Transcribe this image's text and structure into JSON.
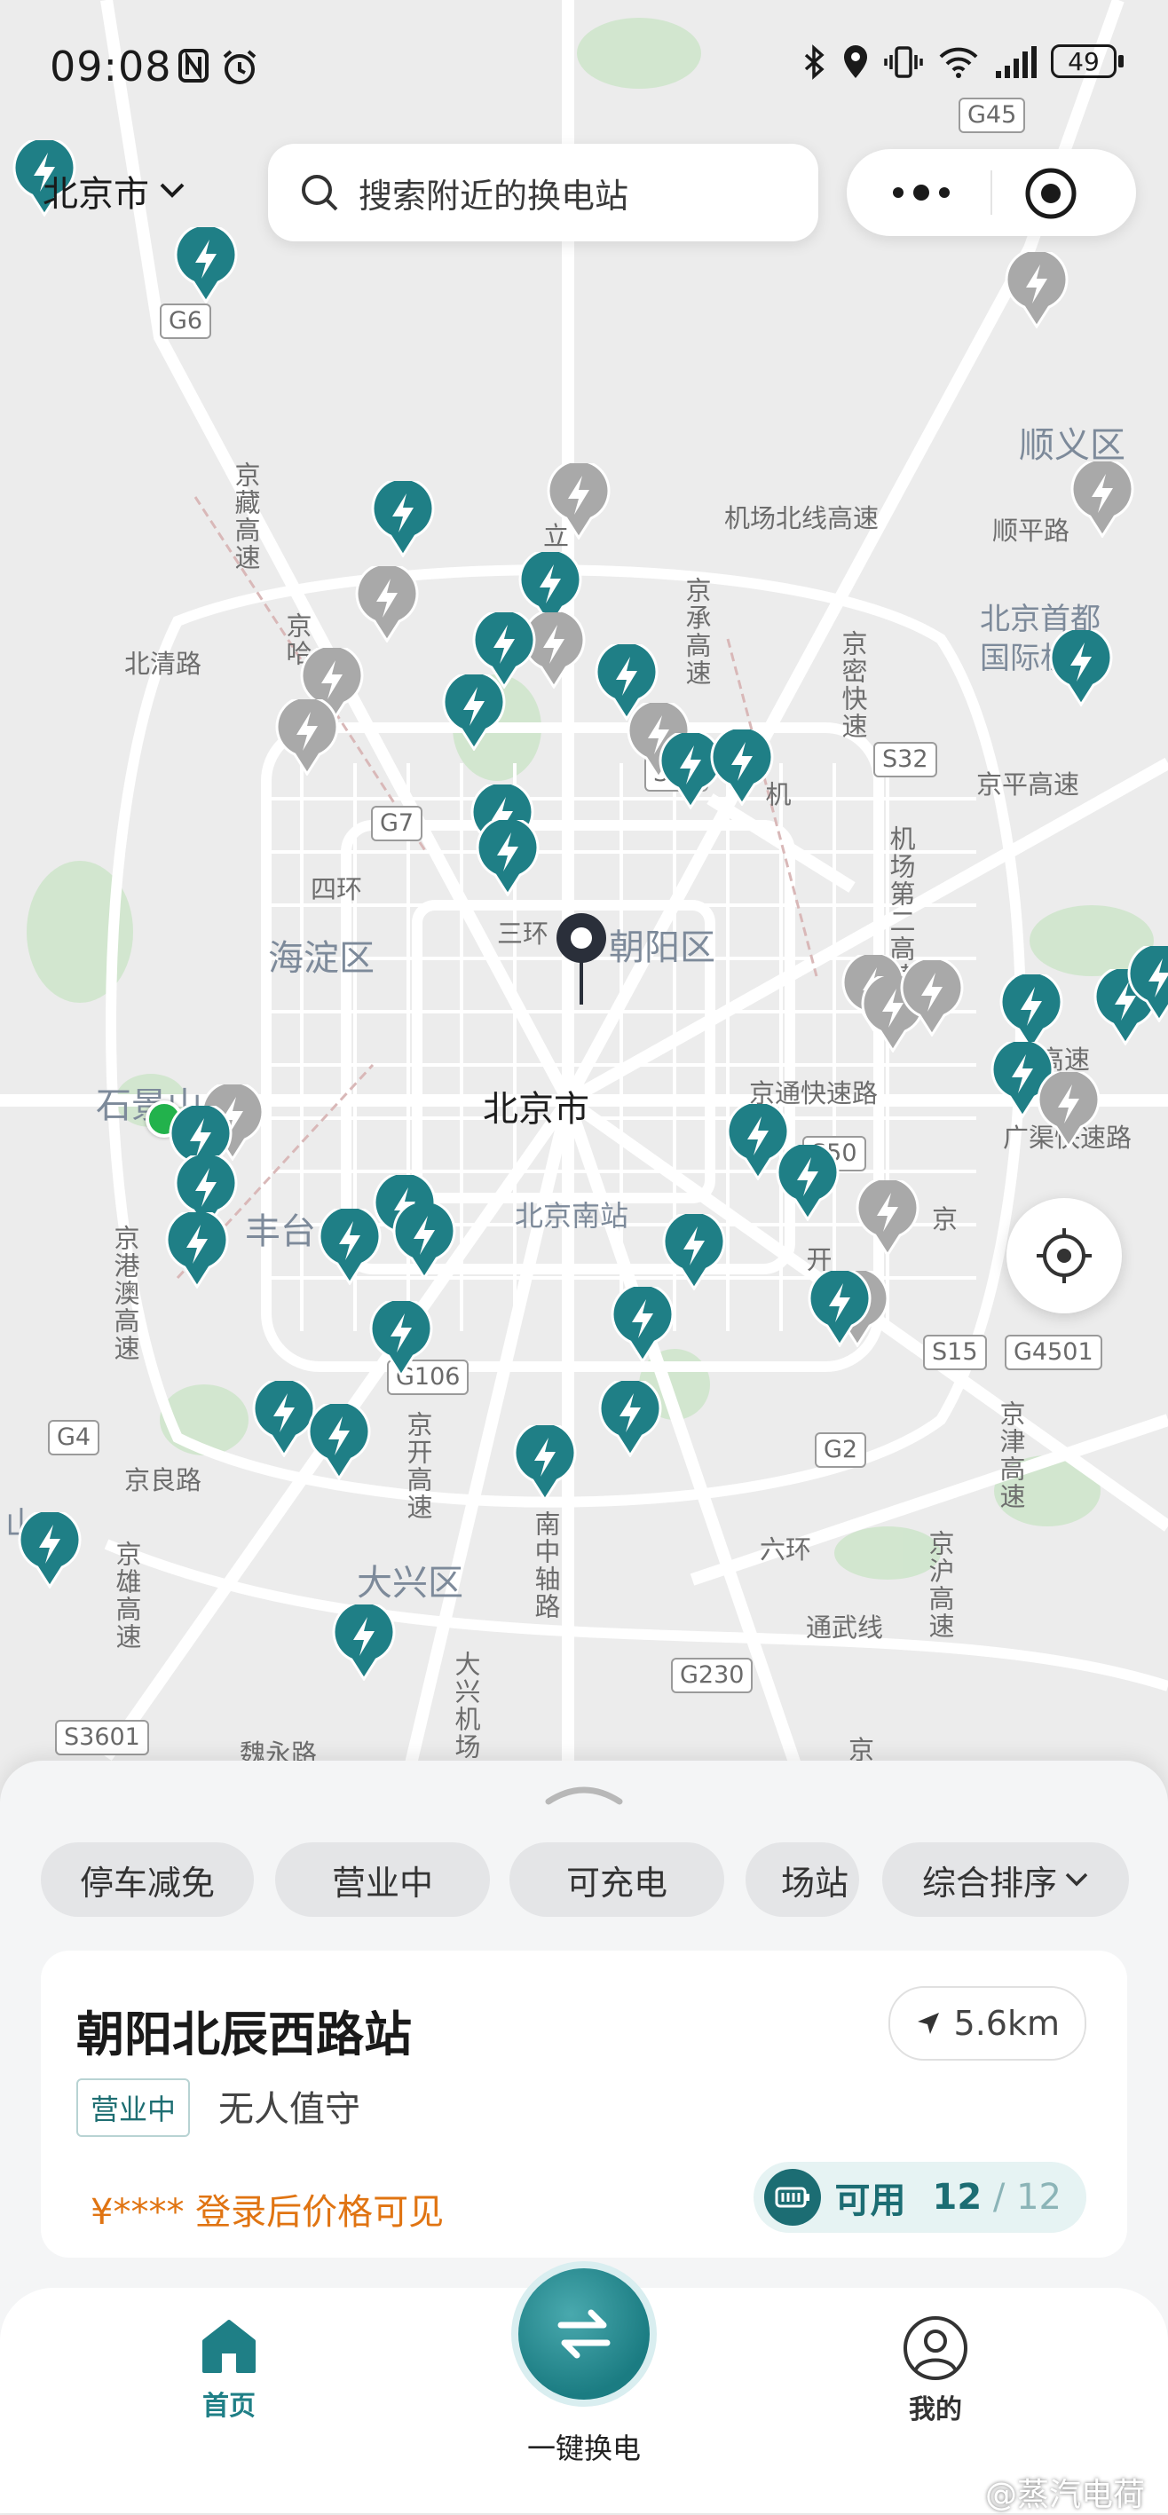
{
  "status_bar": {
    "time": "09:08",
    "battery": "49"
  },
  "header": {
    "city": "北京市",
    "search_placeholder": "搜索附近的换电站"
  },
  "map_labels": {
    "district_shunyi": "顺义区",
    "district_haidian": "海淀区",
    "district_chaoyang": "朝阳区",
    "district_shijingshan": "石景山",
    "district_fengtai": "丰台",
    "district_daxing": "大兴区",
    "city_center": "北京市",
    "airport": "北京首都国际机场",
    "south_station": "北京南站",
    "roads": {
      "jichang_north": "机场北线高速",
      "shunping": "顺平路",
      "beiqing": "北清路",
      "sihuan": "四环",
      "sanhuan": "三环",
      "jingping": "京平高速",
      "jingtong": "京通快速路",
      "guangqu": "广渠快速路",
      "jingliang": "京良路",
      "liuhuan": "六环",
      "tongwu": "通武线",
      "ji": "机",
      "jingzang": "京藏高速",
      "jingcheng": "京承高速",
      "jingmi": "京密快速",
      "jichang2": "机场第二高速",
      "gaosu": "高速",
      "jinggang_ao": "京港澳高速",
      "jingkai": "京开高速",
      "nanzhongzhou": "南中轴路",
      "jingxiong": "京雄高速",
      "jingjin": "京津高速",
      "jinghu": "京沪高速",
      "daxing_jc": "大兴机场",
      "jingha": "京哈",
      "shuiyong": "魏永路",
      "li": "立",
      "jing_s": "京",
      "jing_s2": "京",
      "kai": "开",
      "shan": "山"
    },
    "shields": [
      "G45",
      "G6",
      "G7",
      "S32",
      "S11",
      "S50",
      "S15",
      "G4501",
      "G2",
      "G106",
      "G4",
      "G230",
      "S3601"
    ]
  },
  "filters": {
    "chips": [
      "停车减免",
      "营业中",
      "可充电",
      "场站",
      "综合排序"
    ]
  },
  "station": {
    "name": "朝阳北辰西路站",
    "distance": "5.6km",
    "status": "营业中",
    "duty": "无人值守",
    "price": "¥**** 登录后价格可见",
    "avail_label": "可用",
    "avail_count": "12",
    "avail_total": "12"
  },
  "bottom_nav": {
    "home": "首页",
    "swap": "一键换电",
    "mine": "我的"
  },
  "watermark": "@蒸汽电荷",
  "colors": {
    "teal": "#1f7f86",
    "gray_pin": "#a9a9a9",
    "orange": "#e07412",
    "green_dot": "#22b24c"
  }
}
